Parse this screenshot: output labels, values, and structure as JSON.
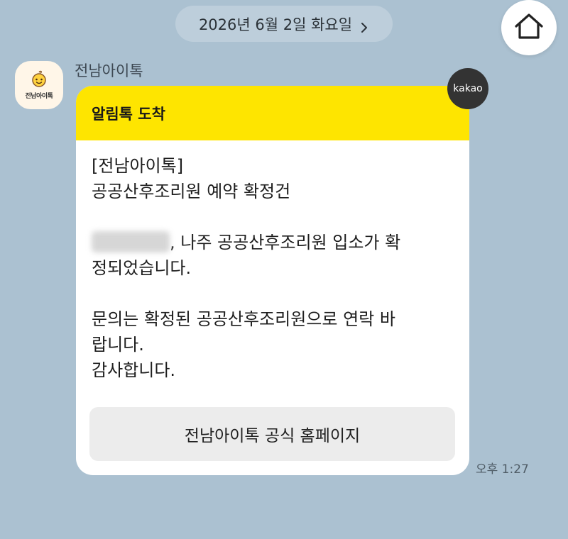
{
  "date_pill": {
    "label": "2026년 6월 2일 화요일"
  },
  "header": {
    "home_icon": "home-icon"
  },
  "sender": {
    "name": "전남아이톡",
    "avatar_label": "전남아이톡"
  },
  "message": {
    "header_title": "알림톡 도착",
    "badge": "kakao",
    "line1": "[전남아이톡]",
    "line2": "공공산후조리원 예약 확정건",
    "line3_suffix": ", 나주 공공산후조리원 입소가 확",
    "line4": "정되었습니다.",
    "line5": "문의는 확정된 공공산후조리원으로 연락 바",
    "line6": "랍니다.",
    "line7": "감사합니다.",
    "button_label": "전남아이톡 공식 홈페이지",
    "timestamp": "오후 1:27"
  },
  "colors": {
    "background": "#abc1d1",
    "header_yellow": "#fee500",
    "badge_dark": "#333333"
  }
}
